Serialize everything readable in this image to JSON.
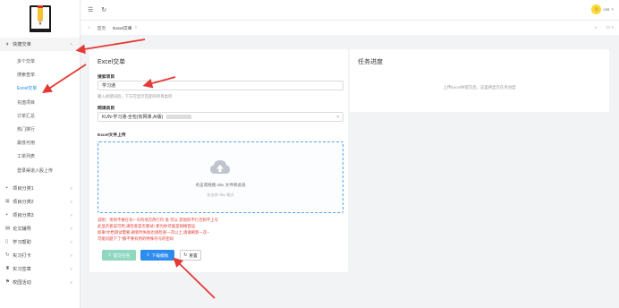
{
  "topbar": {
    "user_name": "cxs"
  },
  "tabs": {
    "home": "首页",
    "current": "Excel交单"
  },
  "sidebar": {
    "expanded_group": "快捷交单",
    "sub_items": [
      "多个交单",
      "搜索查单",
      "Excel交单",
      "充值项目",
      "订单汇总",
      "热门排行",
      "最低可用",
      "工单列表",
      "登录渠道入股上传"
    ],
    "groups": [
      "项目分类1",
      "项目分类2",
      "项目分类3",
      "论文辅导",
      "学习帮助",
      "实习打卡",
      "实习签章",
      "校园活动"
    ]
  },
  "excel_card": {
    "title": "Excel交单",
    "search_label": "搜索项目",
    "search_value": "学习通",
    "search_hint": "输入关键词后，下方可显示匹配的项目类目",
    "channel_label": "网课类目",
    "channel_value": "KUN-学习通-全包(有网课,AI版)",
    "upload_label": "Excel文件上传",
    "upload_text": "点击或拖拽 xlsx 文件到此处",
    "upload_sub": "仅支持 xlsx 格式",
    "note_lines": [
      "说明：项目不要在有+-号的地方改行符 会 可以 其他的不行否则不上号",
      "此显示者说可用,请检查是否重试!  那为你可能是网络错误",
      "如果/文档测试需要,刷新时失败也请检查一次以上,请请刷新一次--",
      "可能问题下了*额不要有用的特殊符号的密码"
    ],
    "submit_label": "提交任务",
    "download_label": "下载模板",
    "reset_label": "重置"
  },
  "progress_card": {
    "title": "任务进度",
    "empty_text": "上传Excel并提交后，这里将显示任务进度"
  }
}
